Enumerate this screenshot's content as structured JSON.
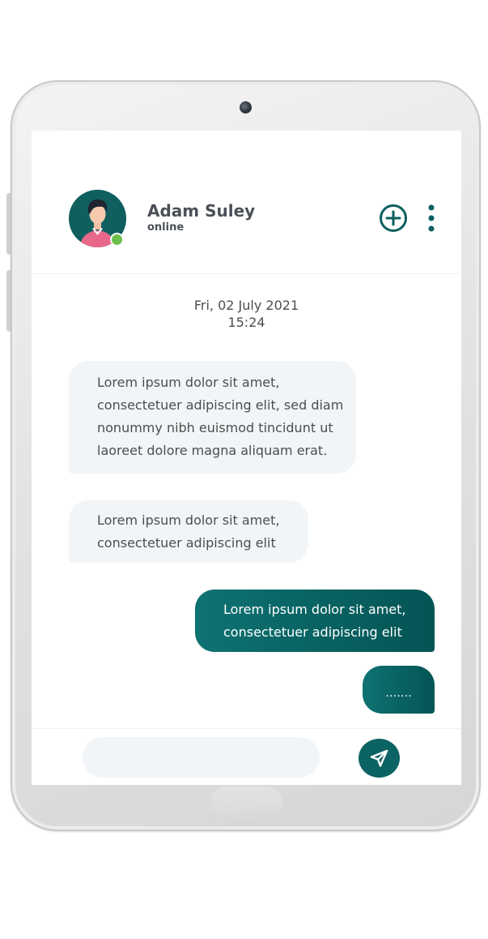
{
  "contact": {
    "name": "Adam Suley",
    "status": "online",
    "avatar_icon": "person-avatar-icon",
    "status_color": "#6cc04a"
  },
  "header": {
    "add_icon": "plus-circle-icon",
    "more_icon": "vertical-ellipsis-icon"
  },
  "conversation": {
    "date": "Fri, 02 July 2021",
    "time": "15:24",
    "messages": [
      {
        "direction": "incoming",
        "text": "Lorem ipsum dolor sit amet,\nconsectetuer adipiscing elit, sed diam\nnonummy nibh euismod tincidunt ut\nlaoreet dolore magna aliquam erat."
      },
      {
        "direction": "incoming",
        "text": "Lorem ipsum dolor sit amet,\nconsectetuer adipiscing elit"
      },
      {
        "direction": "outgoing",
        "text": "Lorem ipsum dolor sit amet,\nconsectetuer adipiscing elit"
      },
      {
        "direction": "outgoing",
        "text": "……."
      }
    ]
  },
  "composer": {
    "placeholder": "",
    "value": "",
    "send_icon": "send-arrow-icon"
  },
  "colors": {
    "accent": "#0c6363",
    "incoming_bubble": "#f2f5f8",
    "text": "#4d4d4d"
  }
}
